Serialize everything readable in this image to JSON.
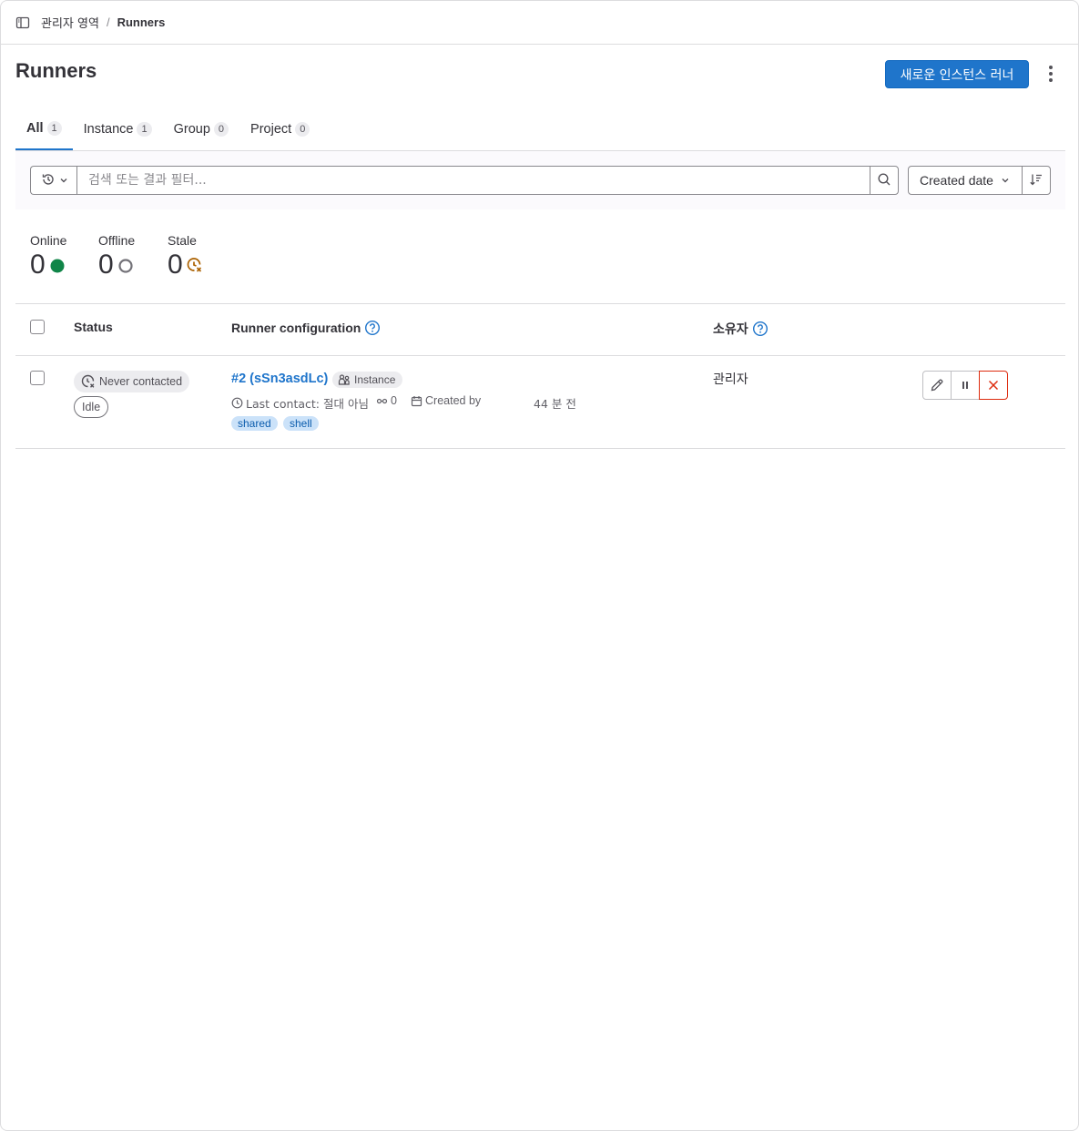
{
  "breadcrumb": {
    "parent": "관리자 영역",
    "separator": "/",
    "current": "Runners"
  },
  "header": {
    "title": "Runners",
    "new_runner_label": "새로운 인스턴스 러너"
  },
  "tabs": [
    {
      "label": "All",
      "count": "1",
      "active": true
    },
    {
      "label": "Instance",
      "count": "1"
    },
    {
      "label": "Group",
      "count": "0"
    },
    {
      "label": "Project",
      "count": "0"
    }
  ],
  "filter": {
    "placeholder": "검색 또는 결과 필터...",
    "sort_label": "Created date"
  },
  "stats": [
    {
      "label": "Online",
      "value": "0",
      "icon": "online-dot-icon",
      "color": "#108548"
    },
    {
      "label": "Offline",
      "value": "0",
      "icon": "offline-circle-icon",
      "color": "#737278"
    },
    {
      "label": "Stale",
      "value": "0",
      "icon": "stale-clock-icon",
      "color": "#ab6100"
    }
  ],
  "table": {
    "columns": {
      "status": "Status",
      "config": "Runner configuration",
      "owner": "소유자"
    },
    "rows": [
      {
        "status_primary": "Never contacted",
        "status_secondary": "Idle",
        "runner_name": "#2 (sSn3asdLc)",
        "runner_type": "Instance",
        "last_contact": "Last contact: 절대 아님",
        "jobs": "0",
        "created_by": "Created by",
        "created_ago": "44 분 전",
        "tags": [
          "shared",
          "shell"
        ],
        "owner": "관리자"
      }
    ]
  },
  "colors": {
    "accent": "#1f75cb",
    "danger": "#dd2b0e",
    "tag_bg": "#cbe2f9"
  }
}
